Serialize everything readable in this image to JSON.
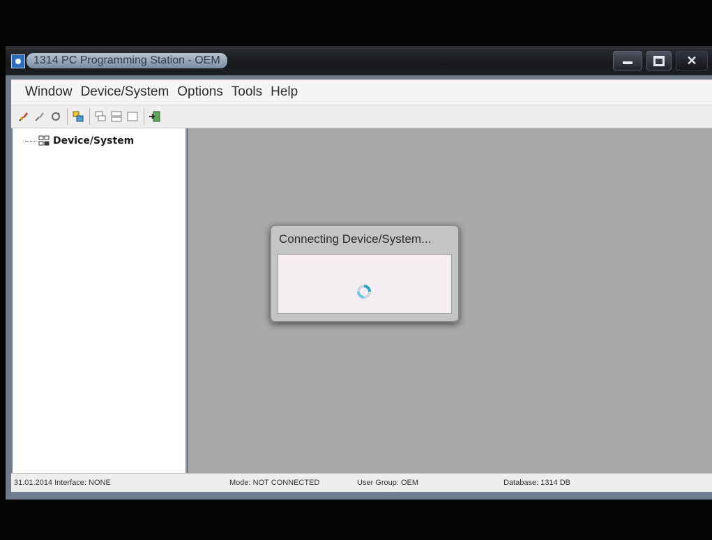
{
  "window": {
    "title": "1314 PC Programming Station - OEM"
  },
  "menu": [
    "Window",
    "Device/System",
    "Options",
    "Tools",
    "Help"
  ],
  "toolbar": {
    "buttons": [
      {
        "icon": "connect-icon"
      },
      {
        "icon": "disconnect-icon"
      },
      {
        "icon": "refresh-icon"
      },
      {
        "icon": "database-icon"
      },
      {
        "icon": "cascade-windows-icon"
      },
      {
        "icon": "tile-windows-icon"
      },
      {
        "icon": "single-window-icon"
      },
      {
        "icon": "exit-icon"
      }
    ]
  },
  "tree": {
    "root_label": "Device/System",
    "root_icon": "device-system-icon"
  },
  "dialog": {
    "title": "Connecting Device/System...",
    "icon": "loading-spinner-icon"
  },
  "status": {
    "date_interface": "31.01.2014  Interface: NONE",
    "mode": "Mode: NOT CONNECTED",
    "user_group": "User Group: OEM",
    "database": "Database: 1314 DB"
  },
  "colors": {
    "workspace": "#a9a9a9",
    "spinner_accent": "#2aa3c9"
  }
}
